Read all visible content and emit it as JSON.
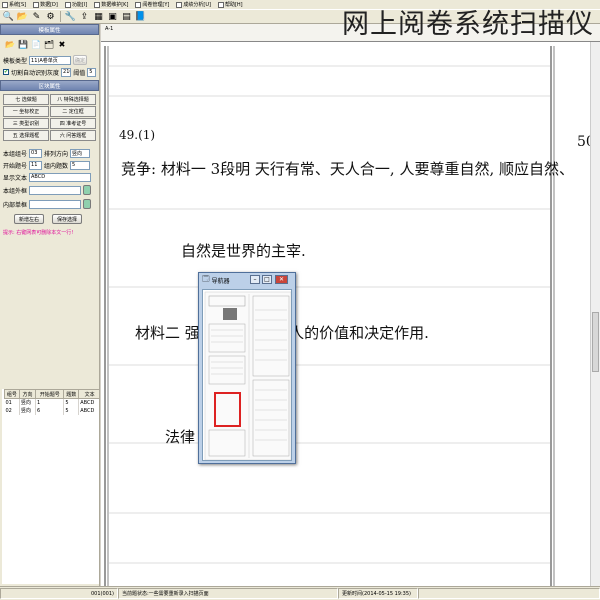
{
  "menu": [
    "系统[S]",
    "数据[D]",
    "功能[I]",
    "数据维护[K]",
    "阅卷管理[Y]",
    "成绩分析[U]",
    "帮助[H]"
  ],
  "app_title": "网上阅卷系统扫描仪",
  "left_panel": {
    "template_props_header": "模板属性",
    "template_type_label": "模板类型",
    "template_type_value": "11)A卷单页",
    "confirm_button": "确定",
    "auto_gray_label": "切割自动识别灰度",
    "gray_value": "210",
    "threshold_label": "阈值",
    "threshold_value": "5",
    "block_props_header": "区块属性",
    "block_buttons": [
      "七 选做题",
      "八 特殊选择题",
      "一 坐标校正",
      "二 定位框",
      "三 类型识别",
      "四 准考证号",
      "五 选择题框",
      "六 问答题框"
    ],
    "group_no_label": "本组组号",
    "group_no_value": "03",
    "direction_label": "排列方向",
    "direction_value": "竖向",
    "start_no_label": "开始题号",
    "start_no_value": "11",
    "count_label": "组内题数",
    "count_value": "5",
    "display_text_label": "显示文本",
    "display_text_value": "ABCD",
    "outer_box_label": "本组外框",
    "inner_box_label": "内部单框",
    "add_button": "新增左右",
    "save_button": "保存选择",
    "hint": "提示: 右键网表可删除本文一行!",
    "table": {
      "headers": [
        "组号",
        "方向",
        "开始题号",
        "题数",
        "文本"
      ],
      "rows": [
        [
          "01",
          "竖向",
          "1",
          "5",
          "ABCD"
        ],
        [
          "02",
          "竖向",
          "6",
          "5",
          "ABCD"
        ]
      ]
    }
  },
  "document": {
    "tab": "A-1",
    "question_no": "49.(1)",
    "line1": "竞争: 材料一 3段明 天行有常、天人合一, 人要尊重自然, 顺应自然、",
    "line2": "自然是世界的主宰.",
    "line3": "材料二 强             的尺度, 突出人的价值和决定作用.",
    "line4": "法律                   而非自然.",
    "margin_score": "50."
  },
  "navigator": {
    "title": "导航器",
    "min": "–",
    "max": "□",
    "close": "✕"
  },
  "status": {
    "page": "001(001)",
    "message": "当前题状态:一些需要重新录入扫描页面",
    "update_time": "更新时间(2014-05-15 19:35)"
  },
  "colors": {
    "accent": "#6f84b0",
    "hint": "#e0119a",
    "highlight_box": "#dd2222"
  }
}
